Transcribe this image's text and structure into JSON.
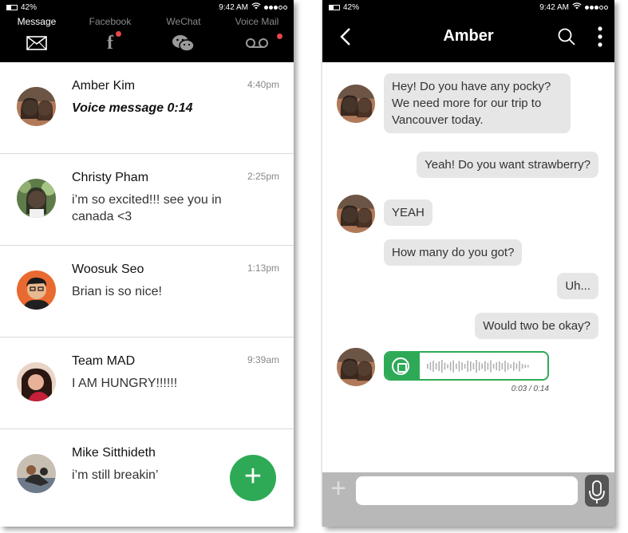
{
  "status_bar": {
    "battery": "42%",
    "time": "9:42 AM"
  },
  "left": {
    "tabs": [
      {
        "label": "Message",
        "icon": "envelope-icon",
        "active": true,
        "notification": false
      },
      {
        "label": "Facebook",
        "icon": "facebook-icon",
        "active": false,
        "notification": true
      },
      {
        "label": "WeChat",
        "icon": "wechat-icon",
        "active": false,
        "notification": false
      },
      {
        "label": "Voice Mail",
        "icon": "voicemail-icon",
        "active": false,
        "notification": true
      }
    ],
    "conversations": [
      {
        "name": "Amber Kim",
        "time": "4:40pm",
        "preview": "Voice message 0:14",
        "voice": true
      },
      {
        "name": "Christy Pham",
        "time": "2:25pm",
        "preview": "i’m so excited!!! see you in canada <3",
        "voice": false
      },
      {
        "name": "Woosuk Seo",
        "time": "1:13pm",
        "preview": "Brian is so nice!",
        "voice": false
      },
      {
        "name": "Team MAD",
        "time": "9:39am",
        "preview": "I AM HUNGRY!!!!!!",
        "voice": false
      },
      {
        "name": "Mike Sitthideth",
        "time": "",
        "preview": "i’m still breakin’",
        "voice": false
      }
    ],
    "fab_label": "+"
  },
  "right": {
    "title": "Amber",
    "messages": [
      {
        "dir": "in",
        "text": "Hey! Do you have any pocky? We need more for our trip to Vancouver today."
      },
      {
        "dir": "out",
        "text": "Yeah! Do you want strawberry?"
      },
      {
        "dir": "in",
        "text": "YEAH"
      },
      {
        "dir": "in",
        "text": "How many do you got?"
      },
      {
        "dir": "out",
        "text": "Uh..."
      },
      {
        "dir": "out",
        "text": "Would two be okay?"
      }
    ],
    "voice_message": {
      "elapsed": "0:03",
      "duration": "0:14",
      "progress": 0.21,
      "display": "0:03 / 0:14"
    },
    "input_placeholder": "",
    "plus_label": "+"
  },
  "colors": {
    "accent_green": "#2eaa56",
    "notification_red": "#e8464a",
    "header_black": "#000000",
    "bubble_gray": "#e6e6e6"
  }
}
